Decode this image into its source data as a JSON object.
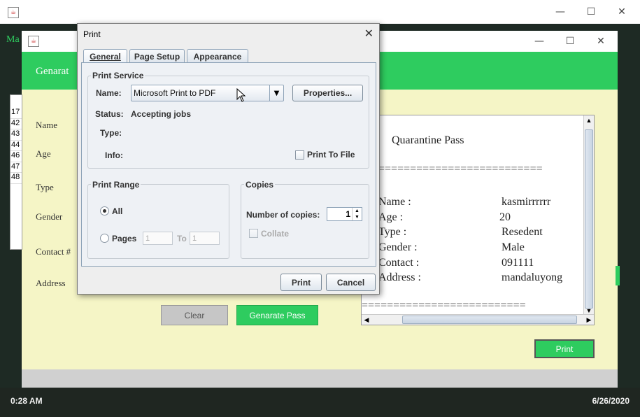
{
  "outer_window": {
    "left_text": "Ma"
  },
  "app": {
    "banner_text": "Genarat",
    "list_numbers": [
      "17",
      "42",
      "43",
      "44",
      "46",
      "47",
      "48"
    ],
    "labels": {
      "name": "Name",
      "age": "Age",
      "type": "Type",
      "gender": "Gender",
      "contact": "Contact #",
      "address": "Address"
    },
    "clear_button": "Clear",
    "generate_button": "Genarate Pass",
    "print_button": "Print"
  },
  "receipt": {
    "title": "Quarantine Pass",
    "separator": "==========================",
    "rows": [
      {
        "label": "Name :",
        "value": "kasmirrrrrr"
      },
      {
        "label": "Age :",
        "value": "20"
      },
      {
        "label": "Type :",
        "value": "Resedent"
      },
      {
        "label": "Gender :",
        "value": "Male"
      },
      {
        "label": "Contact :",
        "value": "091111"
      },
      {
        "label": "Address :",
        "value": "mandaluyong"
      }
    ]
  },
  "print_dialog": {
    "title": "Print",
    "tabs": [
      "General",
      "Page Setup",
      "Appearance"
    ],
    "print_service": {
      "section_title": "Print Service",
      "name_label": "Name:",
      "printer_name": "Microsoft Print to PDF",
      "properties_button": "Properties...",
      "status_label": "Status:",
      "status_value": "Accepting jobs",
      "type_label": "Type:",
      "info_label": "Info:",
      "print_to_file_label": "Print To File"
    },
    "print_range": {
      "section_title": "Print Range",
      "all_label": "All",
      "pages_label": "Pages",
      "from_value": "1",
      "to_label": "To",
      "to_value": "1"
    },
    "copies": {
      "section_title": "Copies",
      "number_label": "Number of copies:",
      "number_value": "1",
      "collate_label": "Collate"
    },
    "print_button": "Print",
    "cancel_button": "Cancel"
  },
  "status_bar": {
    "time": "0:28 AM",
    "date": "6/26/2020"
  }
}
